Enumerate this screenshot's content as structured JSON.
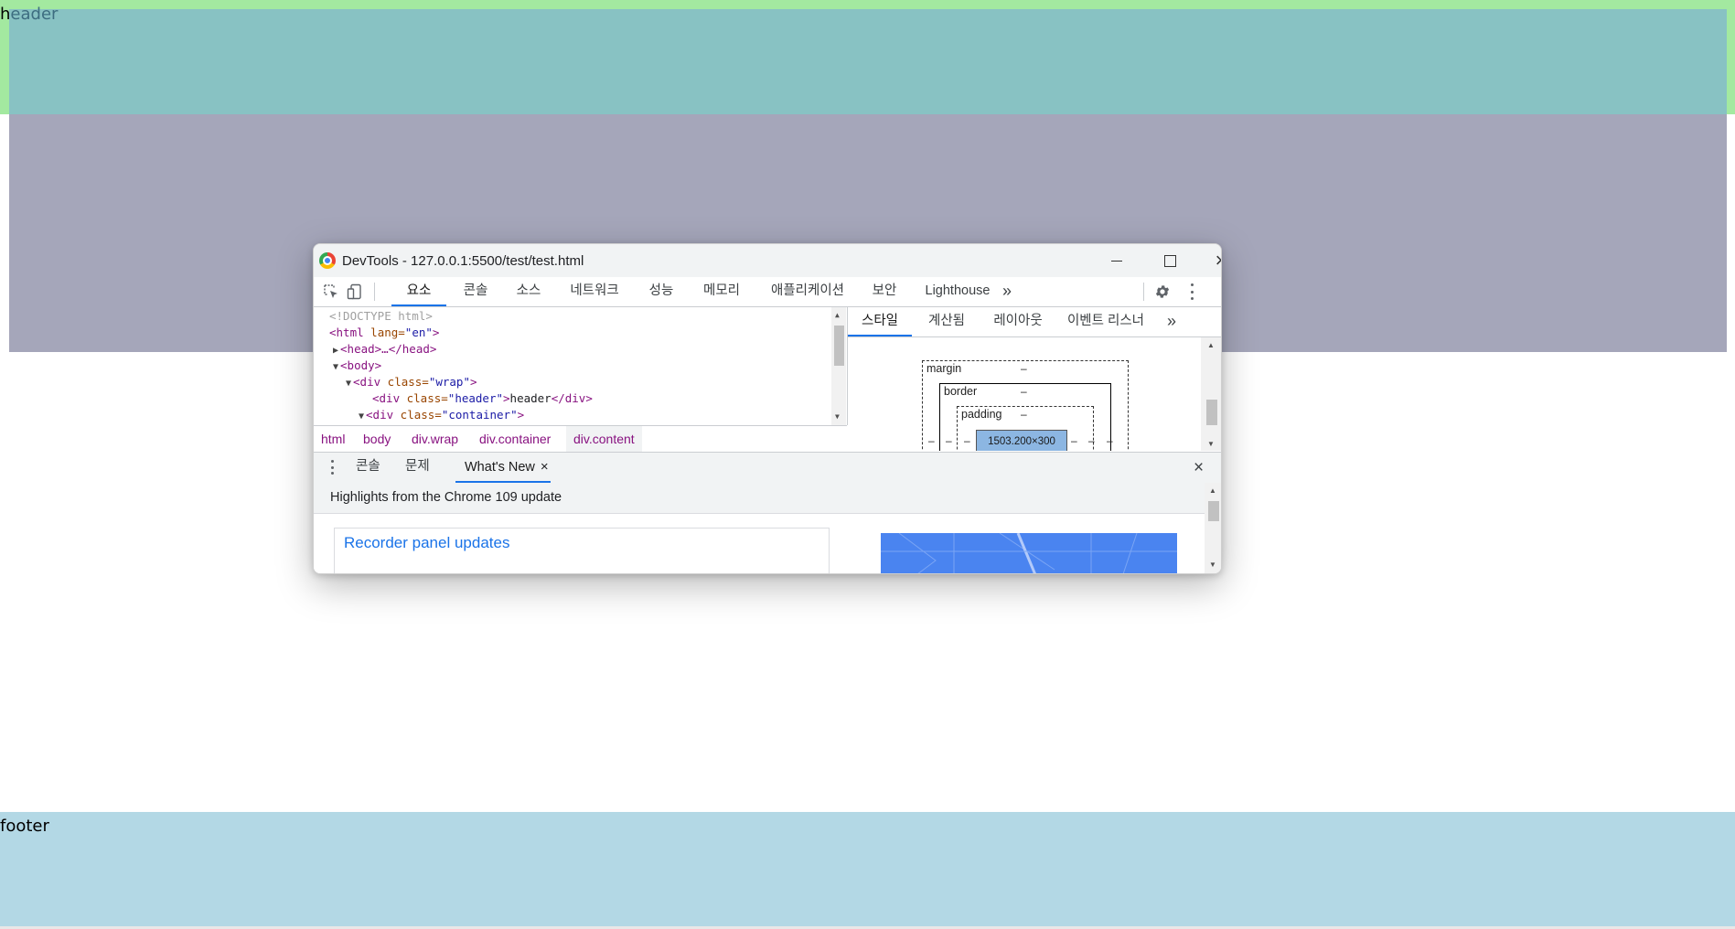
{
  "page": {
    "header_first_letter": "h",
    "header_rest": "eader",
    "footer_text": "footer",
    "colors": {
      "header_bg": "#a3e9a0",
      "header_overlay": "#88c2c3",
      "content": "#a5a6ba",
      "footer": "#b3d8e5"
    }
  },
  "devtools": {
    "window_title": "DevTools - 127.0.0.1:5500/test/test.html",
    "window_controls": {
      "minimize": "minimize-icon",
      "maximize": "maximize-icon",
      "close": "×"
    },
    "toolbar": {
      "icons": [
        "inspect-icon",
        "device-toggle-icon"
      ],
      "tabs": [
        "요소",
        "콘솔",
        "소스",
        "네트워크",
        "성능",
        "메모리",
        "애플리케이션",
        "보안",
        "Lighthouse"
      ],
      "more": "»",
      "active_tab": "요소"
    },
    "elements": {
      "lines": {
        "doctype": "<!DOCTYPE html>",
        "html_open_tag": "<html",
        "html_attr": " lang=",
        "html_val": "\"en\"",
        "html_close": ">",
        "head": "<head>…</head>",
        "body": "<body>",
        "wrap_tag": "<div",
        "wrap_attr": " class=",
        "wrap_val": "\"wrap\"",
        "wrap_close": ">",
        "header_tag": "<div",
        "header_attr": " class=",
        "header_val": "\"header\"",
        "header_gt": ">",
        "header_text": "header",
        "header_end": "</div>",
        "container_tag": "<div",
        "container_attr": " class=",
        "container_val": "\"container\"",
        "container_close": ">"
      },
      "breadcrumb": [
        "html",
        "body",
        "div.wrap",
        "div.container",
        "div.content"
      ]
    },
    "styles": {
      "tabs": [
        "스타일",
        "계산됨",
        "레이아웃",
        "이벤트 리스너"
      ],
      "more": "»",
      "box_model": {
        "margin_label": "margin",
        "border_label": "border",
        "padding_label": "padding",
        "dash": "–",
        "content_size": "1503.200×300"
      }
    },
    "drawer": {
      "tabs": [
        "콘솔",
        "문제",
        "What's New"
      ],
      "active_close": "×",
      "close": "×",
      "whats_new_heading": "Highlights from the Chrome 109 update",
      "card_title": "Recorder panel updates"
    }
  }
}
